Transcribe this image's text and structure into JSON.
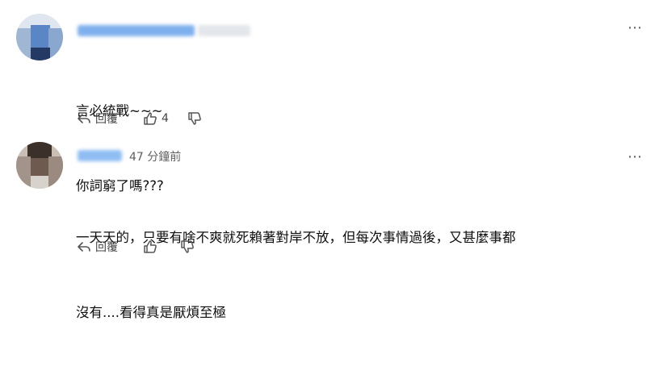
{
  "comments": [
    {
      "text_lines": [
        "言必統戰~~~",
        "你詞窮了嗎???"
      ],
      "time": "",
      "reply_label": "回覆",
      "like_count": "4",
      "more_icon": "⋯"
    },
    {
      "text_lines": [
        "一天天的，只要有啥不爽就死賴著對岸不放，但每次事情過後，又甚麼事都",
        "沒有....看得真是厭煩至極"
      ],
      "time": "47 分鐘前",
      "reply_label": "回覆",
      "like_count": "",
      "more_icon": "⋯"
    }
  ],
  "colors": {
    "name_blur_1": "#7fb0ee",
    "name_blur_2": "#8fbdf2",
    "icon_gray": "#555555"
  }
}
